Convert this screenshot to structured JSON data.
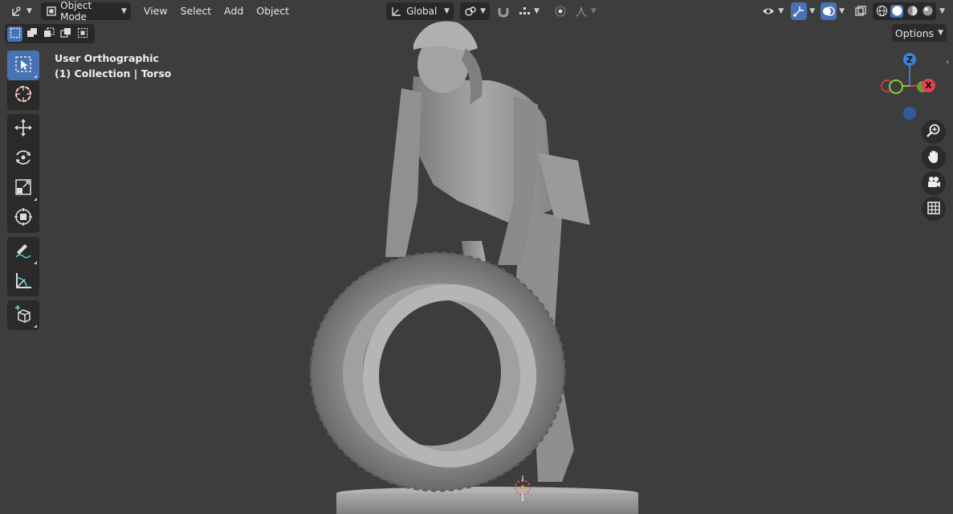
{
  "header": {
    "mode": "Object Mode",
    "menus": [
      "View",
      "Select",
      "Add",
      "Object"
    ],
    "transform_orientation": "Global"
  },
  "viewport": {
    "view_name": "User Orthographic",
    "collection_info": "(1) Collection | Torso",
    "options_label": "Options"
  },
  "gizmo": {
    "z_label": "Z",
    "x_label": "X",
    "colors": {
      "x": "#e5404f",
      "y": "#80c73a",
      "z": "#3e81db"
    }
  },
  "colors": {
    "accent": "#4772b3",
    "panel": "#2a2a2a",
    "background": "#3d3d3d"
  },
  "icons": {
    "toolbar": [
      "select-box-icon",
      "cursor-icon",
      "move-icon",
      "rotate-icon",
      "scale-icon",
      "transform-icon",
      "annotate-icon",
      "measure-icon",
      "add-cube-icon"
    ],
    "navigation": [
      "zoom-icon",
      "hand-icon",
      "camera-icon",
      "grid-icon"
    ]
  }
}
